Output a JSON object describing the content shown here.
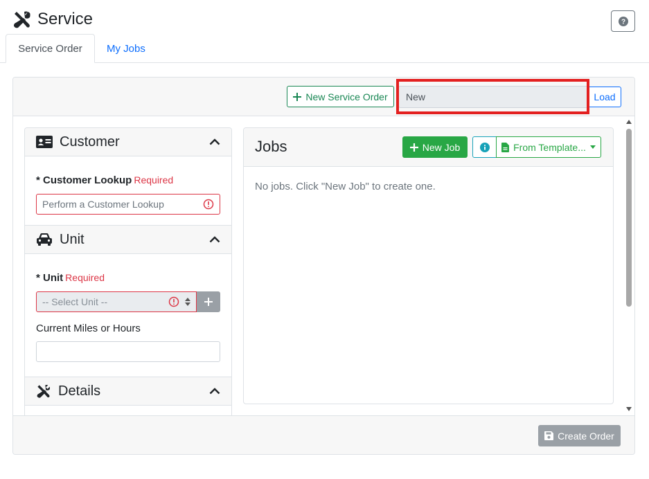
{
  "header": {
    "title": "Service",
    "title_icon": "tools-icon",
    "help_icon": "question-circle-icon"
  },
  "tabs": [
    {
      "label": "Service Order",
      "active": true
    },
    {
      "label": "My Jobs",
      "active": false
    }
  ],
  "toolbar": {
    "new_service_order_label": "New Service Order",
    "service_order_value": "New",
    "load_label": "Load"
  },
  "sections": {
    "customer": {
      "title": "Customer",
      "icon": "id-card-icon",
      "lookup_label": "* Customer Lookup",
      "required_text": "Required",
      "lookup_placeholder": "Perform a Customer Lookup"
    },
    "unit": {
      "title": "Unit",
      "icon": "car-icon",
      "unit_label": "* Unit",
      "required_text": "Required",
      "select_placeholder": "-- Select Unit --",
      "miles_label": "Current Miles or Hours",
      "miles_value": ""
    },
    "details": {
      "title": "Details",
      "icon": "tools-icon"
    }
  },
  "jobs": {
    "title": "Jobs",
    "new_job_label": "New Job",
    "from_template_label": "From Template...",
    "empty_message": "No jobs. Click \"New Job\" to create one."
  },
  "footer": {
    "create_order_label": "Create Order"
  },
  "colors": {
    "primary": "#0d6efd",
    "success": "#28a745",
    "danger": "#dc3545",
    "highlight": "#e32020",
    "disabled": "#9aa0a6"
  }
}
